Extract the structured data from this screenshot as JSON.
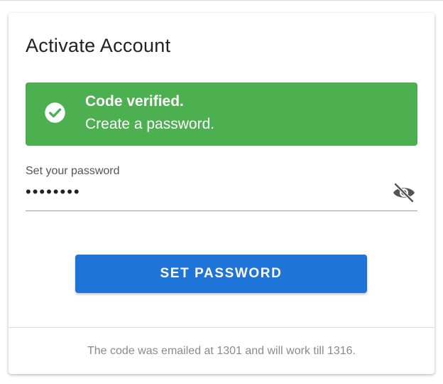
{
  "card": {
    "title": "Activate Account"
  },
  "alert": {
    "icon": "check-circle-icon",
    "title": "Code verified.",
    "message": "Create a password.",
    "color": "#4caf50"
  },
  "password_field": {
    "label": "Set your password",
    "value": "secretpw",
    "toggle_icon": "eye-off-icon"
  },
  "primary_button": {
    "label": "SET PASSWORD",
    "color": "#1f74d7"
  },
  "footer": {
    "note": "The code was emailed at 1301 and will work till 1316."
  }
}
